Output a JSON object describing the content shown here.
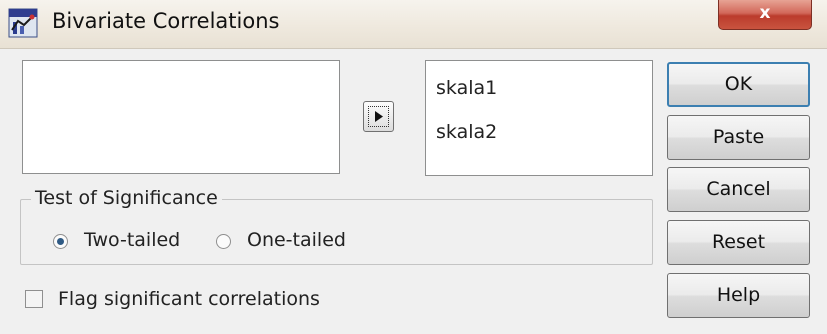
{
  "window": {
    "title": "Bivariate Correlations",
    "close_symbol": "x",
    "icon": "spss-dialog-icon"
  },
  "source_list": {
    "items": []
  },
  "target_list": {
    "items": [
      "skala1",
      "skala2"
    ]
  },
  "move_button": {
    "icon": "arrow-right-icon"
  },
  "buttons": {
    "ok": "OK",
    "paste": "Paste",
    "cancel": "Cancel",
    "reset": "Reset",
    "help": "Help"
  },
  "significance": {
    "title": "Test of Significance",
    "options": [
      {
        "label": "Two-tailed",
        "selected": true
      },
      {
        "label": "One-tailed",
        "selected": false
      }
    ]
  },
  "flag_checkbox": {
    "label": "Flag significant correlations",
    "checked": false
  },
  "colors": {
    "close_red": "#c9543f",
    "default_button_border": "#3c7fb1",
    "radio_dot": "#2f5a84"
  }
}
